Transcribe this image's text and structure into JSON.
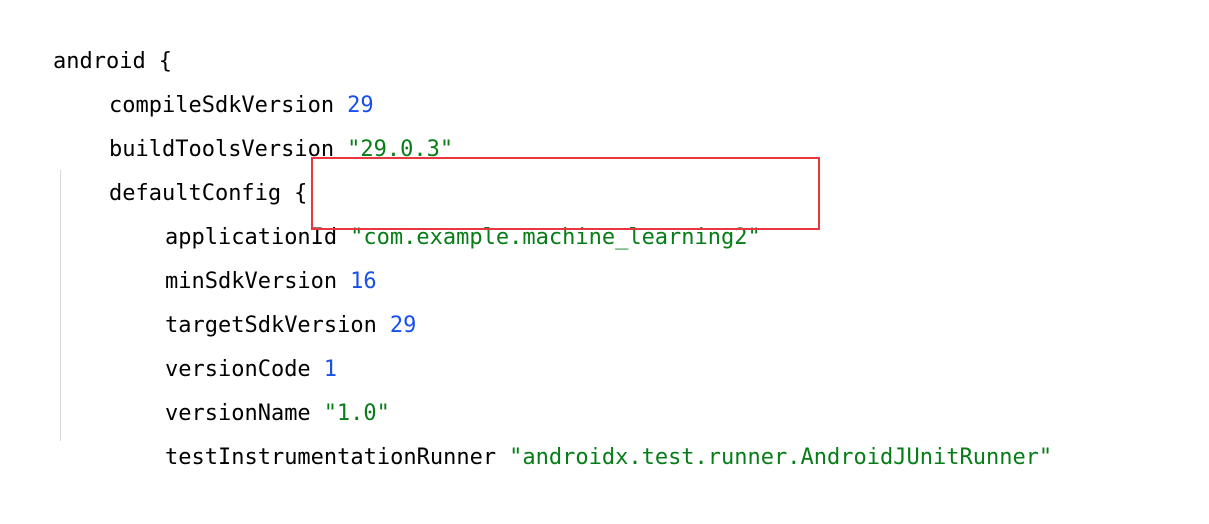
{
  "lines": [
    {
      "key": "android",
      "punct": "{"
    },
    {
      "key": "compileSdkVersion",
      "value": "29"
    },
    {
      "key": "buildToolsVersion",
      "value": "\"29.0.3\""
    },
    {
      "key": "defaultConfig",
      "punct": "{"
    },
    {
      "key": "applicationId",
      "value": "\"com.example.machine_learning2\""
    },
    {
      "key": "minSdkVersion",
      "value": "16"
    },
    {
      "key": "targetSdkVersion",
      "value": "29"
    },
    {
      "key": "versionCode",
      "value": "1"
    },
    {
      "key": "versionName",
      "value": "\"1.0\""
    },
    {
      "key": "testInstrumentationRunner",
      "value": "\"androidx.test.runner.AndroidJUnitRunner\""
    }
  ],
  "colors": {
    "keyword": "#000000",
    "number": "#1750eb",
    "string": "#067d17",
    "highlight": "#e8383d",
    "indent_guide": "#d9d9d9"
  }
}
